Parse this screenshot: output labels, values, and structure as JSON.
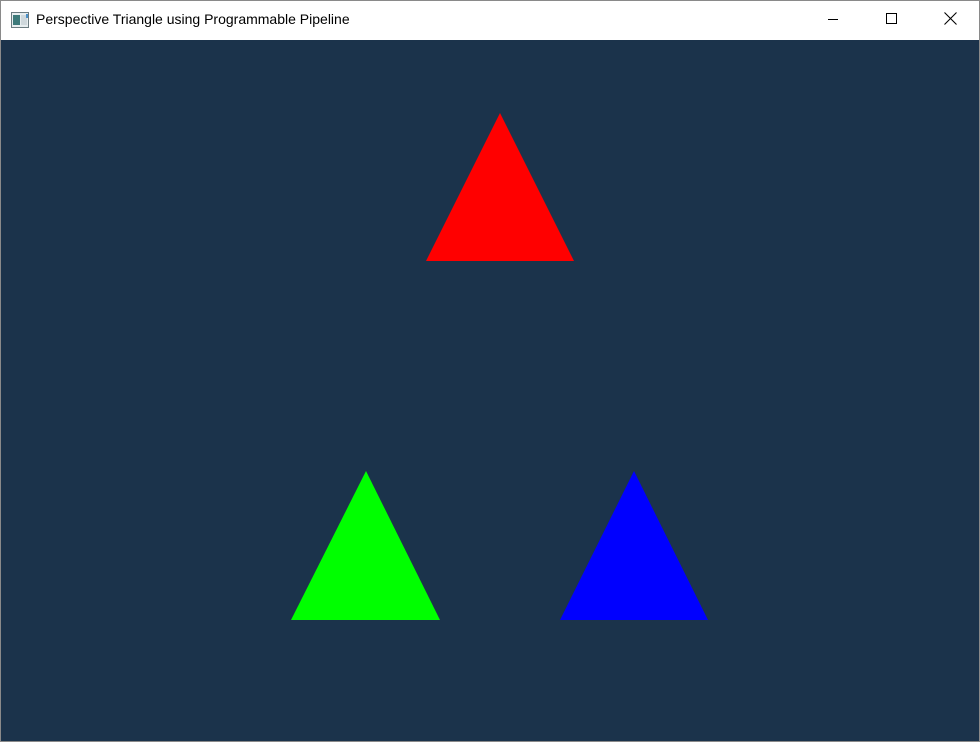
{
  "window": {
    "title": "Perspective Triangle using Programmable Pipeline",
    "background_color": "#1b334b",
    "titlebar_icons": {
      "app": "app-window-icon",
      "minimize": "minimize-icon",
      "maximize": "maximize-icon",
      "close": "close-icon"
    }
  },
  "scene": {
    "triangles": [
      {
        "name": "red-triangle",
        "color": "#ff0000"
      },
      {
        "name": "green-triangle",
        "color": "#00ff00"
      },
      {
        "name": "blue-triangle",
        "color": "#0000ff"
      }
    ]
  }
}
